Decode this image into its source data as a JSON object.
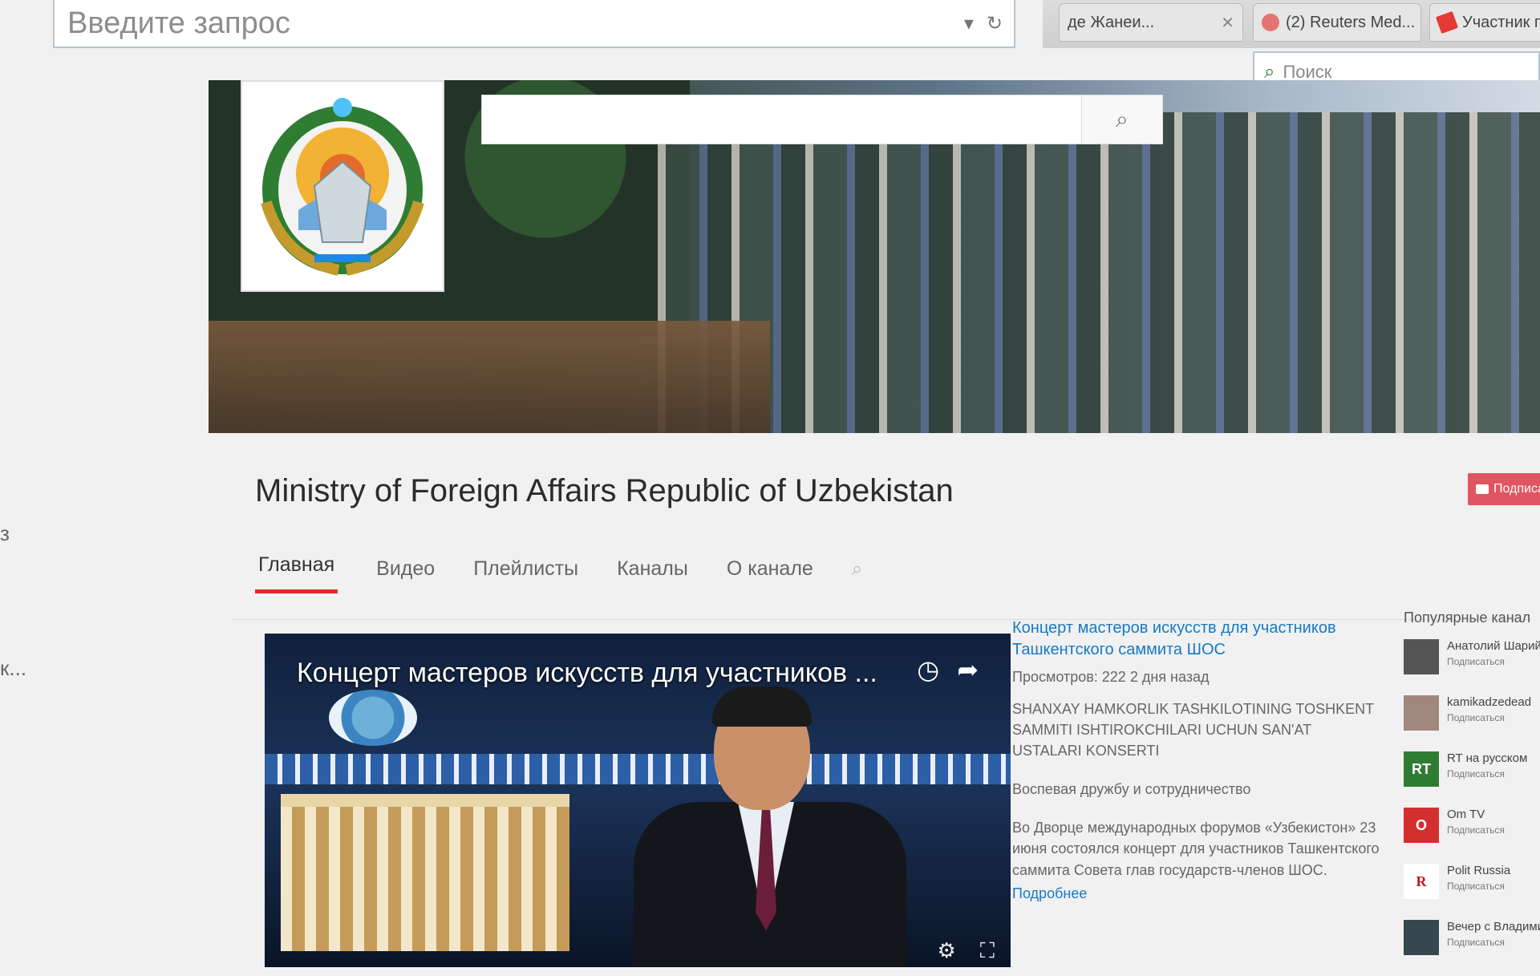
{
  "browser": {
    "address_placeholder": "Введите запрос",
    "search_placeholder": "Поиск",
    "tabs": [
      {
        "label": "де Жанеи..."
      },
      {
        "label": "(2) Reuters Med..."
      },
      {
        "label": "Участник погр..."
      }
    ]
  },
  "channel": {
    "title": "Ministry of Foreign Affairs Republic of Uzbekistan",
    "subscribe_label": "Подписат",
    "tabs": [
      "Главная",
      "Видео",
      "Плейлисты",
      "Каналы",
      "О канале"
    ],
    "active_tab": "Главная"
  },
  "edge": {
    "text1": "з",
    "text2": "к..."
  },
  "featured": {
    "player_title": "Концерт мастеров искусств для участников ...",
    "title": "Концерт мастеров искусств для участников Ташкентского саммита ШОС",
    "meta": "Просмотров: 222  2 дня назад",
    "p1": "SHANXAY HAMKORLIK TASHKILOTINING TOSHKENT SAMMITI ISHTIROKCHILARI UCHUN SAN'AT USTALARI KONSERTI",
    "p2": "Воспевая дружбу и сотрудничество",
    "p3": "Во Дворце международных форумов «Узбекистон» 23 июня состоялся концерт для участников Ташкентского саммита Совета глав государств-членов ШОС.",
    "more": "Подробнее"
  },
  "popular": {
    "heading": "Популярные канал",
    "subscribe_label": "Подписаться",
    "channels": [
      {
        "name": "Анатолий Шарий",
        "color": "#555555",
        "initials": ""
      },
      {
        "name": "kamikadzedead",
        "color": "#a1887f",
        "initials": ""
      },
      {
        "name": "RT на русском",
        "color": "#2e7d32",
        "initials": "RT"
      },
      {
        "name": "Om TV",
        "color": "#d32f2f",
        "initials": "O"
      },
      {
        "name": "Polit Russia",
        "color": "#ffffff",
        "initials": "R"
      },
      {
        "name": "Вечер с Владимир...",
        "color": "#37474f",
        "initials": ""
      }
    ]
  },
  "colors": {
    "accent": "#e02b2b",
    "link": "#167ac6",
    "subscribe": "#e0555f"
  }
}
